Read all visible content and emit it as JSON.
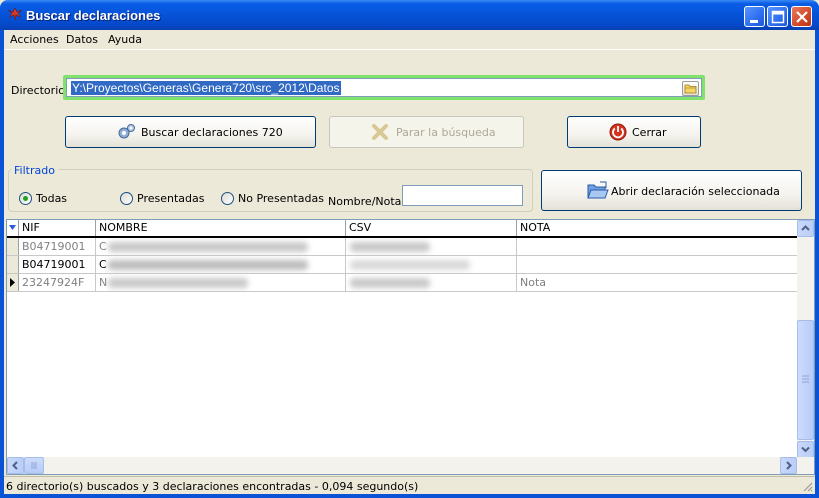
{
  "window": {
    "title": "Buscar declaraciones"
  },
  "menu": {
    "items": [
      {
        "label": "Acciones"
      },
      {
        "label": "Datos"
      },
      {
        "label": "Ayuda"
      }
    ]
  },
  "directory": {
    "label": "Directorio:",
    "value": "Y:\\Proyectos\\Generas\\Genera720\\src_2012\\Datos"
  },
  "buttons": {
    "search_label": "Buscar declaraciones 720",
    "stop_label": "Parar la búsqueda",
    "close_label": "Cerrar",
    "open_label": "Abrir declaración seleccionada"
  },
  "filter": {
    "legend": "Filtrado",
    "options": [
      {
        "label": "Todas",
        "selected": true
      },
      {
        "label": "Presentadas",
        "selected": false
      },
      {
        "label": "No Presentadas",
        "selected": false
      }
    ],
    "note_label": "Nombre/Nota:",
    "note_value": ""
  },
  "grid": {
    "columns": [
      "NIF",
      "NOMBRE",
      "CSV",
      "NOTA"
    ],
    "rows": [
      {
        "nif": "B04719001",
        "nombre": "C",
        "csv": "",
        "nota": "",
        "style": "gray"
      },
      {
        "nif": "B04719001",
        "nombre": "C",
        "csv": "",
        "nota": "",
        "style": "black"
      },
      {
        "nif": "23247924F",
        "nombre": "N",
        "csv": "",
        "nota": "Nota",
        "style": "gray",
        "current": true
      }
    ]
  },
  "status": {
    "text": "6 directorio(s) buscados y 3 declaraciones encontradas - 0,094 segundo(s)"
  },
  "colors": {
    "titlebar": "#0653d8",
    "selection": "#316ac5",
    "focus_border": "#7ee26c",
    "group_legend": "#0046d5"
  }
}
